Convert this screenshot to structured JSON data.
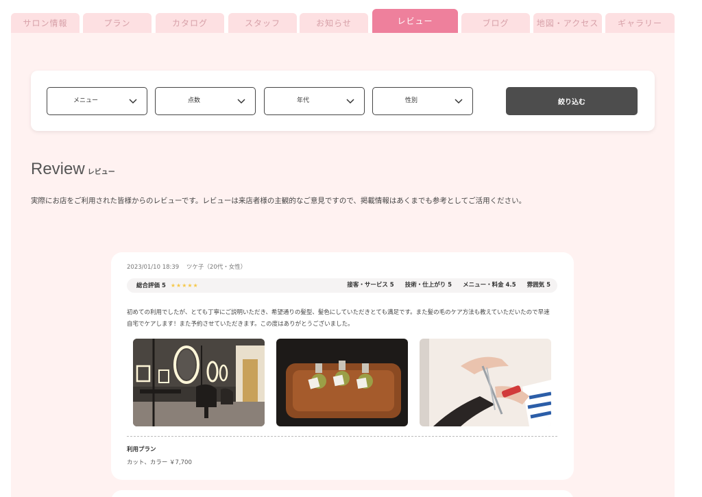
{
  "tabs": [
    {
      "label": "サロン情報",
      "active": false
    },
    {
      "label": "プラン",
      "active": false
    },
    {
      "label": "カタログ",
      "active": false
    },
    {
      "label": "スタッフ",
      "active": false
    },
    {
      "label": "お知らせ",
      "active": false
    },
    {
      "label": "レビュー",
      "active": true
    },
    {
      "label": "ブログ",
      "active": false
    },
    {
      "label": "地図・アクセス",
      "active": false
    },
    {
      "label": "ギャラリー",
      "active": false
    }
  ],
  "filters": {
    "menu_label": "メニュー",
    "score_label": "点数",
    "age_label": "年代",
    "gender_label": "性別",
    "submit_label": "絞り込む"
  },
  "section": {
    "title_en": "Review",
    "title_ja": "レビュー",
    "intro": "実際にお店をご利用された皆様からのレビューです。レビューは来店者様の主観的なご意見ですので、掲載情報はあくまでも参考としてご活用ください。"
  },
  "review": {
    "datetime": "2023/01/10 18:39",
    "author": "ツケ子（20代・女性）",
    "overall_label": "総合評価 5",
    "stars": "★★★★★",
    "scores": [
      "接客・サービス 5",
      "技術・仕上がり 5",
      "メニュー・料金 4.5",
      "雰囲気 5"
    ],
    "text": "初めての利用でしたが、とても丁寧にご説明いただき、希望通りの髪型、髪色にしていただきとても満足です。また髪の毛のケア方法も教えていただいたので早速自宅でケアします！また予約させていただきます。この度はありがとうございました。",
    "photos": [
      "salon-interior-photo",
      "hair-oil-bottles-photo",
      "hair-cutting-photo"
    ],
    "plan_label": "利用プラン",
    "plan_value": "カット、カラー ￥7,700"
  },
  "colors": {
    "accent": "#ee809c",
    "tab_inactive": "#fde0e2",
    "page_bg": "#fff2f1",
    "button_dark": "#4d4d4d",
    "star": "#f5c84a"
  }
}
